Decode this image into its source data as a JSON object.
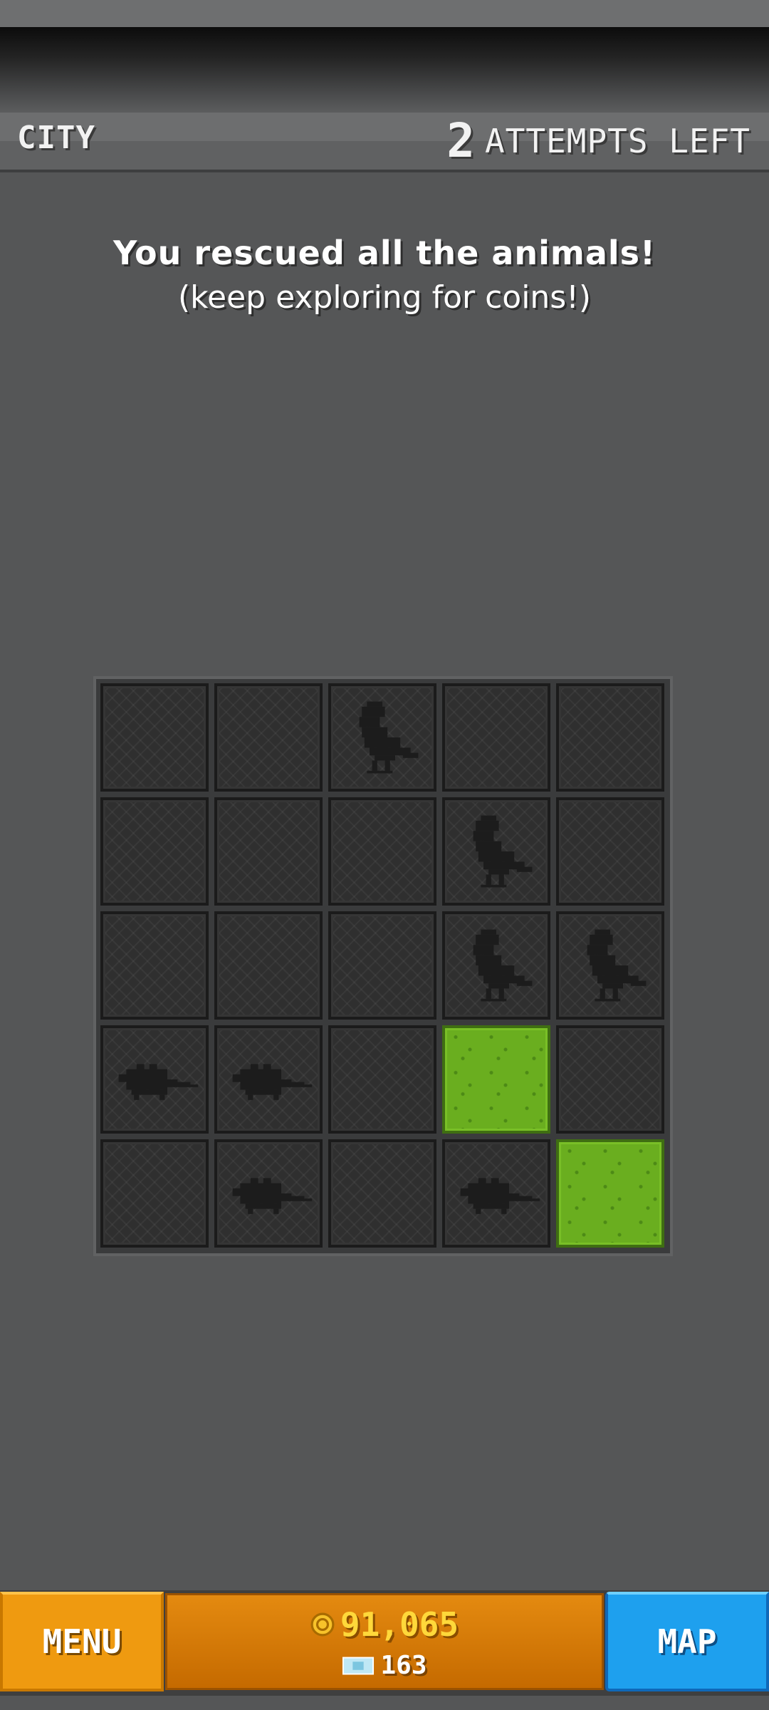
{
  "header": {
    "level_name": "CITY",
    "attempts_count": "2",
    "attempts_label": "ATTEMPTS LEFT"
  },
  "message": {
    "main": "You rescued all the animals!",
    "sub": "(keep exploring for coins!)"
  },
  "grid": {
    "rows": 5,
    "cols": 5,
    "cells": [
      [
        "empty",
        "empty",
        "pigeon",
        "empty",
        "empty"
      ],
      [
        "empty",
        "empty",
        "empty",
        "pigeon",
        "empty"
      ],
      [
        "empty",
        "empty",
        "empty",
        "pigeon",
        "pigeon"
      ],
      [
        "rat",
        "rat",
        "empty",
        "grass",
        "empty"
      ],
      [
        "empty",
        "rat",
        "empty",
        "rat",
        "grass"
      ]
    ],
    "icons": {
      "pigeon": "pigeon-silhouette-icon",
      "rat": "rat-silhouette-icon",
      "grass": "grass-tile",
      "empty": "mesh-tile"
    }
  },
  "footer": {
    "menu_label": "MENU",
    "map_label": "MAP",
    "coins": "91,065",
    "gems": "163",
    "coin_icon": "coin-icon",
    "ticket_icon": "ticket-icon"
  },
  "colors": {
    "menu": "#ef9a10",
    "map": "#1ea0ee",
    "coins": "#ffd83a",
    "grass": "#6aae1f"
  }
}
